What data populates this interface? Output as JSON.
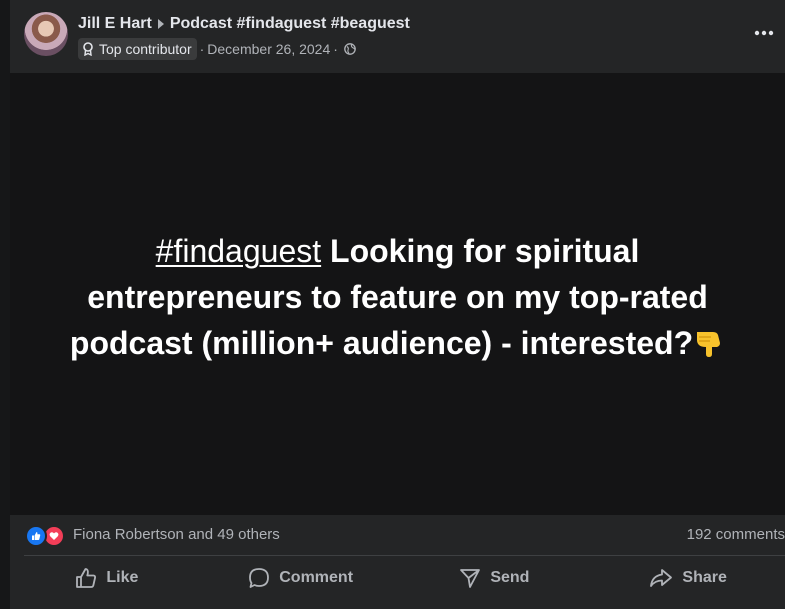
{
  "post": {
    "author": "Jill E Hart",
    "group": "Podcast #findaguest #beaguest",
    "badge": "Top contributor",
    "separator": "·",
    "date": "December 26, 2024",
    "separator2": "·",
    "text": {
      "hashtag": "#findaguest",
      "line1_rest": " Looking for spiritual",
      "line2": "entrepreneurs to feature on my top-rated",
      "line3": "podcast (million+ audience) - interested?"
    }
  },
  "reactions": {
    "names": "Fiona Robertson and 49 others",
    "comments": "192 comments"
  },
  "actions": {
    "like": "Like",
    "comment": "Comment",
    "send": "Send",
    "share": "Share"
  },
  "colors": {
    "background": "#242526",
    "post_body": "#141415",
    "like_blue": "#1877f2",
    "love_red": "#f33e58",
    "secondary_text": "#b0b3b8"
  },
  "icons": [
    "contributor-badge-icon",
    "globe-icon",
    "more-options-icon",
    "like-reaction-icon",
    "love-reaction-icon",
    "thumbs-up-icon",
    "comment-icon",
    "send-icon",
    "share-icon",
    "pointing-down-emoji"
  ]
}
